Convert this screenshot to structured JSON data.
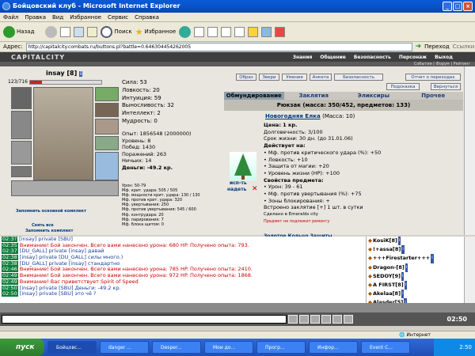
{
  "window": {
    "title": "Бойцовский клуб - Microsoft Internet Explorer"
  },
  "menu": [
    "Файл",
    "Правка",
    "Вид",
    "Избранное",
    "Сервис",
    "Справка"
  ],
  "toolbar": {
    "back": "Назад",
    "search": "Поиск",
    "favorites": "Избранное"
  },
  "address": {
    "label": "Адрес:",
    "url": "http://capitalcity.combats.ru/buttons.pl?battle=0.646304454262005",
    "go": "Переход",
    "links": "Ссылки"
  },
  "site": {
    "logo": "CAPITALCITY",
    "nav": [
      "Знания",
      "Общение",
      "Безопасность",
      "Персонаж",
      "Выход"
    ],
    "subnav": "События | Форум | Рейтинг"
  },
  "character": {
    "nick": "insay",
    "level": "[8]",
    "hp": "123/716",
    "hp_fraction": 0.17,
    "stats": [
      "Сила: 53",
      "Ловкость: 20",
      "Интуиция: 59",
      "Выносливость: 32",
      "Интеллект: 2",
      "Мудрость: 0"
    ],
    "info": [
      "Опыт: 1856548 (2000000)",
      "Уровень: 8",
      "Побед: 1430",
      "Поражений: 263",
      "Ничьих: 14",
      "Деньги: -49.2 кр."
    ],
    "mods": [
      "Урон: 50-79",
      "Мф. крит. удара: 505 / 505",
      "Мф. мощности крит. удара: 130 / 130",
      "Мф. против крит. удара: 320",
      "Мф. увертывания: 250",
      "Мф. против увертывания: 545 / 600",
      "Мф. контрудара: 20",
      "Мф. парирования: 7",
      "Мф. блока щитом: 0"
    ],
    "remember": "Запомнить основной комплект",
    "remove_all": "Снять все",
    "remember_set": "Запомнить комплект"
  },
  "buttons": {
    "top": [
      "Образ",
      "Звери",
      "Умения",
      "Анкета"
    ],
    "security": "Безопасность",
    "transitions": "Отчет о переходах",
    "hint": "Подсказка",
    "return": "Вернуться"
  },
  "tabs": [
    "Обмундирование",
    "Заклятия",
    "Эликсиры",
    "Прочее"
  ],
  "backpack": "Рюкзак (масса: 350/452, предметов: 133)",
  "item": {
    "name": "Новогодняя Елка",
    "mass": "(Масса: 10)",
    "use": "исп-ть",
    "put_on": "надеть",
    "lines": [
      "Цена: 1 кр.",
      "Долговечность: 3/100",
      "Срок жизни: 30 дн. (до 31.01.06)",
      "Действует на:",
      "• Мф. против критического удара (%): +50",
      "• Ловкость: +10",
      "• Защита от магии: +20",
      "• Уровень жизни (HP): +100",
      "Свойства предмета:",
      "• Урон: 39 - 61",
      "• Мф. против увертывания (%): +75",
      "• Зоны блокирования: +",
      "Встроено заклятие [+] 1 шт. в сутки",
      "Сделано в Emeralds city",
      "Предмет не подлежит ремонту"
    ],
    "next": "Золотое Кольцо Защиты"
  },
  "chat": [
    {
      "t": "02:3?",
      "text": "[insay] private [SBU]"
    },
    {
      "t": "02:35",
      "text": "Внимание! Бой закончен. Всего вами нанесено урона: 680 HP. Получено опыта: 793."
    },
    {
      "t": "02:37",
      "text": "[DU_GALL] private [insay] давай"
    },
    {
      "t": "02:38",
      "text": "[insay] private [DU_GALL] силы много.)"
    },
    {
      "t": "02:38",
      "text": "[DU_GALL] private [insay] стандартно"
    },
    {
      "t": "02:46",
      "text": "Внимание! Бой закончен. Всего вами нанесено урона: 785 HP. Получено опыта: 2410."
    },
    {
      "t": "02:49",
      "text": "Внимание! Бой закончен. Всего вами нанесено урона: 972 HP. Получено опыта: 1868."
    },
    {
      "t": "02:49",
      "text": "Внимание! Вас приветствует Spirit of Speed"
    },
    {
      "t": "02:50",
      "text": "[insay] private [SBU] Деньги: -49.2 кр."
    },
    {
      "t": "02:50",
      "text": "[insay] private [SBU] это чё ?"
    }
  ],
  "users": [
    "KosiK[8]",
    "!+assa[8]",
    "+++Firestarter+++",
    "Dragon-[8]",
    "SEDOY[9]",
    "A FIRST[8]",
    "Akelaa[8]",
    "Alasder[5]"
  ],
  "clock": "02:50",
  "status": "Интернет",
  "taskbar": {
    "start": "пуск",
    "tasks": [
      "Бойцовс...",
      "danger ...",
      "Desper...",
      "Мои до...",
      "Прогр...",
      "Инфор...",
      "Event C..."
    ],
    "time": "2:50"
  }
}
